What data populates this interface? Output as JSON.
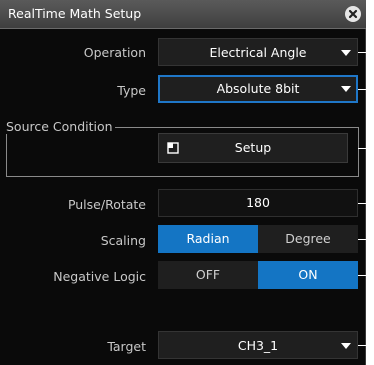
{
  "dialog": {
    "title": "RealTime Math Setup"
  },
  "operation": {
    "label": "Operation",
    "value": "Electrical Angle"
  },
  "type": {
    "label": "Type",
    "value": "Absolute 8bit"
  },
  "source_condition": {
    "label": "Source Condition",
    "setup_label": "Setup"
  },
  "pulse_rotate": {
    "label": "Pulse/Rotate",
    "value": "180"
  },
  "scaling": {
    "label": "Scaling",
    "options": [
      "Radian",
      "Degree"
    ],
    "selected": "Radian"
  },
  "negative_logic": {
    "label": "Negative Logic",
    "options": [
      "OFF",
      "ON"
    ],
    "selected": "ON"
  },
  "target": {
    "label": "Target",
    "value": "CH3_1"
  },
  "colors": {
    "accent": "#1475c4",
    "panel": "#0a0a0a",
    "control": "#1f1f1f"
  }
}
